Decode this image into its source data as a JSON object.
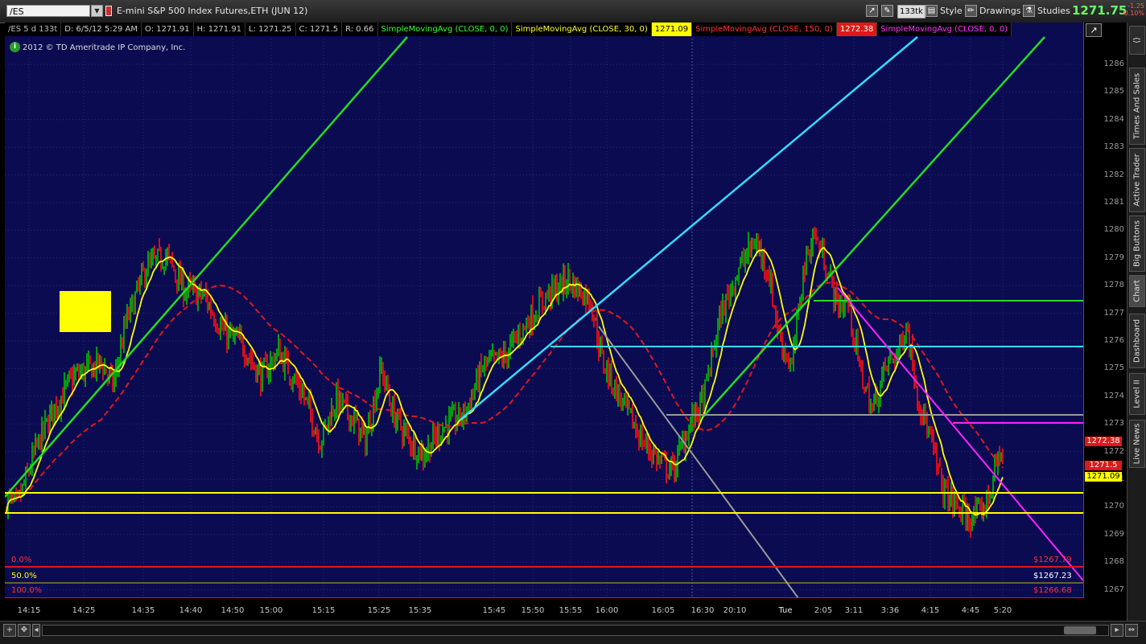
{
  "toolbar": {
    "symbol": "/ES",
    "description": "E-mini S&P 500 Index Futures,ETH (JUN 12)",
    "tick_agg": "133tk",
    "style_label": "Style",
    "drawings_label": "Drawings",
    "studies_label": "Studies",
    "last_price": "1271.75",
    "net_change": "-1.25",
    "net_change_pct": "-0.10%"
  },
  "info_row": {
    "aggregation": "/ES 5 d 133t",
    "date": "D: 6/5/12 5:29 AM",
    "open": "O: 1271.91",
    "high": "H: 1271.91",
    "low": "L: 1271.25",
    "close": "C: 1271.5",
    "range": "R: 0.66",
    "sma1_label": "SimpleMovingAvg (CLOSE, 0, 0)",
    "sma2_label": "SimpleMovingAvg (CLOSE, 30, 0)",
    "sma2_value": "1271.09",
    "sma3_label": "SimpleMovingAvg (CLOSE, 150, 0)",
    "sma3_value": "1272.38",
    "sma4_label": "SimpleMovingAvg (CLOSE, 0, 0)"
  },
  "copyright": "2012 © TD Ameritrade IP Company, Inc.",
  "price_axis": {
    "labels": [
      "1286",
      "1285",
      "1284",
      "1283",
      "1282",
      "1281",
      "1280",
      "1279",
      "1278",
      "1277",
      "1276",
      "1275",
      "1274",
      "1273",
      "1272",
      "1271",
      "1270",
      "1269",
      "1268",
      "1267"
    ],
    "badges": [
      {
        "text": "1272.38",
        "bg": "#e01818",
        "fg": "#ffffff"
      },
      {
        "text": "1271.5",
        "bg": "#e01818",
        "fg": "#ffffff"
      },
      {
        "text": "1271.09",
        "bg": "#ffff00",
        "fg": "#000000"
      }
    ]
  },
  "fibonacci": {
    "levels": [
      {
        "pct": "0.0%",
        "price": "$1267.79",
        "color": "#ff3030"
      },
      {
        "pct": "50.0%",
        "price": "$1267.23",
        "color": "#ffff00"
      },
      {
        "pct": "100.0%",
        "price": "$1266.68",
        "color": "#ff3030"
      }
    ]
  },
  "time_axis": [
    "14:15",
    "14:25",
    "14:35",
    "14:40",
    "14:50",
    "15:00",
    "15:15",
    "15:25",
    "15:35",
    "15:45",
    "15:50",
    "15:55",
    "16:00",
    "16:05",
    "16:30",
    "20:10",
    "Tue",
    "2:05",
    "3:11",
    "3:36",
    "4:15",
    "4:45",
    "5:20"
  ],
  "right_tabs": [
    "Times And Sales",
    "Active Trader",
    "Big Buttons",
    "Chart",
    "Dashboard",
    "Level II",
    "Live News"
  ],
  "colors": {
    "chart_bg": "#0b0b52",
    "up_bar": "#00c000",
    "down_bar": "#ff1010",
    "sma_fast": "#ffff00",
    "sma_slow": "#e01818",
    "trend_green": "#22dd22",
    "trend_cyan": "#33ddff",
    "trend_magenta": "#ff22ff",
    "trend_gray": "#9a9a9a"
  }
}
